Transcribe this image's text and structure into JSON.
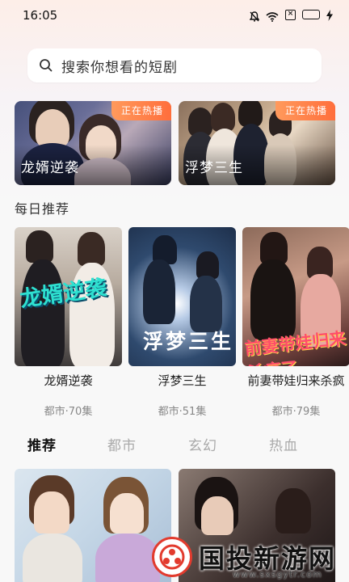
{
  "status_bar": {
    "time": "16:05",
    "icons": [
      "bell-mute-icon",
      "wifi-icon",
      "x-box-icon",
      "battery-icon",
      "charging-bolt-icon"
    ]
  },
  "search": {
    "placeholder": "搜索你想看的短剧",
    "icon": "search-icon"
  },
  "banners": [
    {
      "title": "龙婿逆袭",
      "badge": "正在热播"
    },
    {
      "title": "浮梦三生",
      "badge": "正在热播"
    }
  ],
  "daily": {
    "section_title": "每日推荐",
    "items": [
      {
        "name": "龙婿逆袭",
        "meta": "都市·70集",
        "poster_text": "龙婿逆袭"
      },
      {
        "name": "浮梦三生",
        "meta": "都市·51集",
        "poster_text": "浮梦三生"
      },
      {
        "name": "前妻带娃归来杀疯",
        "meta": "都市·79集",
        "poster_text": "前妻带娃归来杀疯了"
      }
    ]
  },
  "tabs": [
    {
      "label": "推荐",
      "active": true
    },
    {
      "label": "都市",
      "active": false
    },
    {
      "label": "玄幻",
      "active": false
    },
    {
      "label": "热血",
      "active": false
    }
  ],
  "watermark": {
    "text": "国投新游网",
    "url": "www.sxsgytr.com"
  },
  "colors": {
    "badge": "#ff7a45",
    "active_tab": "#111111",
    "inactive_tab": "#aaaaaa"
  }
}
